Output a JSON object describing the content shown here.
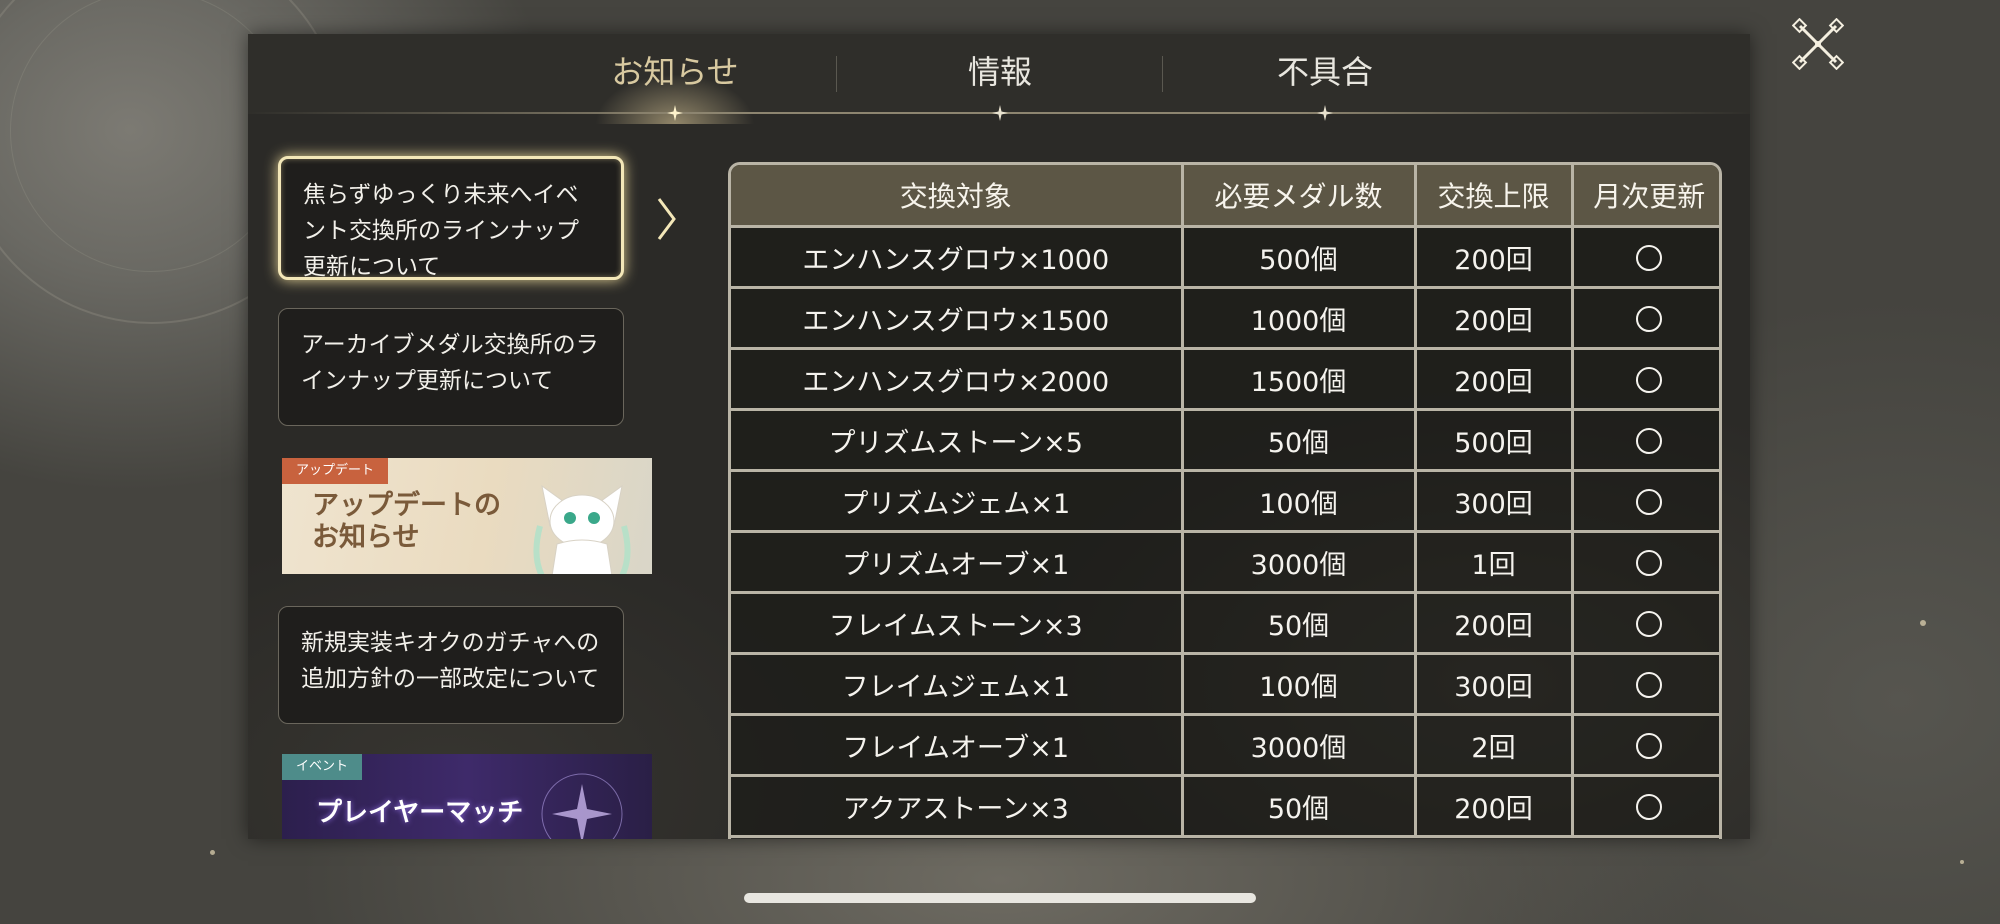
{
  "tabs": [
    {
      "label": "お知らせ",
      "active": true
    },
    {
      "label": "情報",
      "active": false
    },
    {
      "label": "不具合",
      "active": false
    }
  ],
  "notices": [
    {
      "title": "焦らずゆっくり未来へイベント交換所のラインナップ更新について",
      "selected": true
    },
    {
      "title": "アーカイブメダル交換所のラインナップ更新について",
      "selected": false
    },
    {
      "title": "新規実装キオクのガチャへの追加方針の一部改定について",
      "selected": false
    }
  ],
  "banners": {
    "update": {
      "tag": "アップデート",
      "title_line1": "アップデートの",
      "title_line2": "お知らせ"
    },
    "event": {
      "tag": "イベント",
      "title": "プレイヤーマッチ"
    }
  },
  "table": {
    "headers": [
      "交換対象",
      "必要メダル数",
      "交換上限",
      "月次更新"
    ],
    "rows": [
      [
        "エンハンスグロウ×1000",
        "500個",
        "200回",
        "○"
      ],
      [
        "エンハンスグロウ×1500",
        "1000個",
        "200回",
        "○"
      ],
      [
        "エンハンスグロウ×2000",
        "1500個",
        "200回",
        "○"
      ],
      [
        "プリズムストーン×5",
        "50個",
        "500回",
        "○"
      ],
      [
        "プリズムジェム×1",
        "100個",
        "300回",
        "○"
      ],
      [
        "プリズムオーブ×1",
        "3000個",
        "1回",
        "○"
      ],
      [
        "フレイムストーン×3",
        "50個",
        "200回",
        "○"
      ],
      [
        "フレイムジェム×1",
        "100個",
        "300回",
        "○"
      ],
      [
        "フレイムオーブ×1",
        "3000個",
        "2回",
        "○"
      ],
      [
        "アクアストーン×3",
        "50個",
        "200回",
        "○"
      ]
    ]
  },
  "colors": {
    "panel": "#2b2a27",
    "header_row": "#5c5645",
    "accent_gold": "#f3e7b8",
    "grid": "#b9b4a6"
  },
  "icons": {
    "close": "close-x-icon",
    "tab_indicator": "sparkle-star-icon",
    "selection": "chevron-right-icon"
  }
}
